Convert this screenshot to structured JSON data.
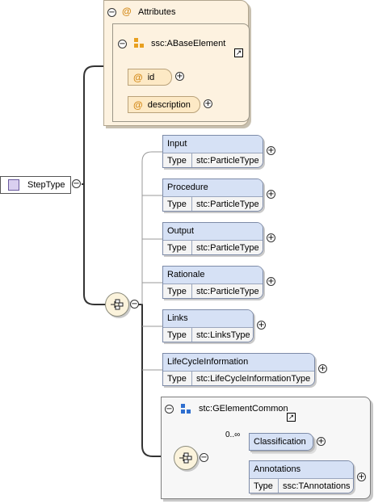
{
  "root": {
    "name": "StepType"
  },
  "attributes": {
    "header": "Attributes",
    "group_name": "ssc:ABaseElement",
    "items": [
      {
        "name": "id"
      },
      {
        "name": "description"
      }
    ]
  },
  "sequence": {
    "elements": [
      {
        "name": "Input",
        "type_label": "Type",
        "type": "stc:ParticleType"
      },
      {
        "name": "Procedure",
        "type_label": "Type",
        "type": "stc:ParticleType"
      },
      {
        "name": "Output",
        "type_label": "Type",
        "type": "stc:ParticleType"
      },
      {
        "name": "Rationale",
        "type_label": "Type",
        "type": "stc:ParticleType"
      },
      {
        "name": "Links",
        "type_label": "Type",
        "type": "stc:LinksType"
      },
      {
        "name": "LifeCycleInformation",
        "type_label": "Type",
        "type": "stc:LifeCycleInformationType"
      }
    ]
  },
  "group": {
    "name": "stc:GElementCommon",
    "multiplicity": "0..∞",
    "classification": "Classification",
    "annotations": {
      "name": "Annotations",
      "type_label": "Type",
      "type": "ssc:TAnnotations"
    }
  },
  "symbols": {
    "expand": "+",
    "collapse": "−",
    "at": "@"
  },
  "colors": {
    "attr_bg": "#fdf2e0",
    "element_header": "#d6e1f5",
    "root_icon": "#d9cff0",
    "group_icon": "#2f6fcf"
  }
}
